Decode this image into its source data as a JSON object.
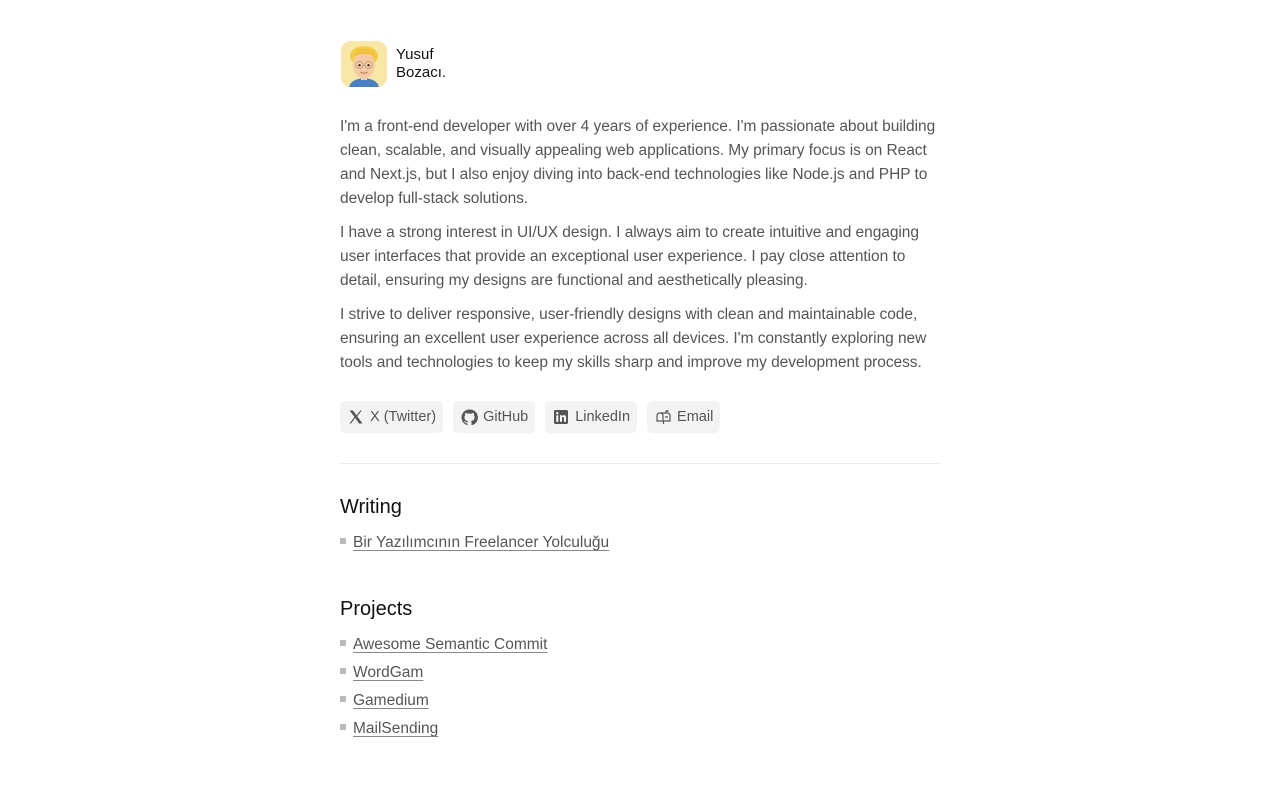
{
  "profile": {
    "first_name": "Yusuf",
    "last_name": "Bozacı.",
    "avatar_icon": "memoji-avatar-icon"
  },
  "bio": {
    "paragraphs": [
      "I'm a front-end developer with over 4 years of experience. I'm passionate about building clean, scalable, and visually appealing web applications. My primary focus is on React and Next.js, but I also enjoy diving into back-end technologies like Node.js and PHP to develop full-stack solutions.",
      "I have a strong interest in UI/UX design. I always aim to create intuitive and engaging user interfaces that provide an exceptional user experience. I pay close attention to detail, ensuring my designs are functional and aesthetically pleasing.",
      "I strive to deliver responsive, user-friendly designs with clean and maintainable code, ensuring an excellent user experience across all devices. I'm constantly exploring new tools and technologies to keep my skills sharp and improve my development process."
    ]
  },
  "socials": [
    {
      "label": "X (Twitter)",
      "icon": "x-twitter-icon"
    },
    {
      "label": "GitHub",
      "icon": "github-icon"
    },
    {
      "label": "LinkedIn",
      "icon": "linkedin-icon"
    },
    {
      "label": "Email",
      "icon": "mailbox-icon"
    }
  ],
  "writing": {
    "title": "Writing",
    "items": [
      "Bir Yazılımcının Freelancer Yolculuğu"
    ]
  },
  "projects": {
    "title": "Projects",
    "items": [
      "Awesome Semantic Commit",
      "WordGam",
      "Gamedium",
      "MailSending"
    ]
  },
  "colors": {
    "text": "#555555",
    "heading": "#111111",
    "chip_bg": "#f3f3f3",
    "bullet": "#b9b9b9",
    "avatar_bg": "#f8e7a6"
  }
}
